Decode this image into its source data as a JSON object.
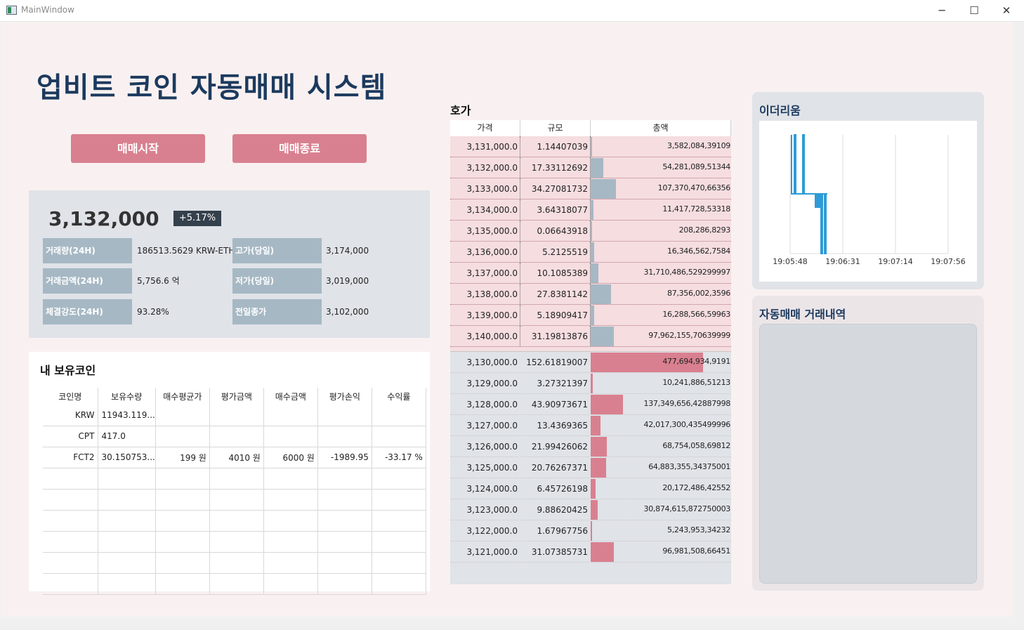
{
  "window": {
    "title": "MainWindow",
    "minimize": "─",
    "maximize": "☐",
    "close": "✕"
  },
  "header": {
    "title": "업비트 코인 자동매매 시스템"
  },
  "actions": {
    "start": "매매시작",
    "stop": "매매종료"
  },
  "ticker": {
    "price": "3,132,000",
    "change": "+5.17%",
    "stats": [
      {
        "label": "거래량(24H)",
        "value": "186513.5629 KRW-ETH"
      },
      {
        "label": "고가(당일)",
        "value": "3,174,000"
      },
      {
        "label": "거래금액(24H)",
        "value": "5,756.6 억"
      },
      {
        "label": "저가(당일)",
        "value": "3,019,000"
      },
      {
        "label": "체결강도(24H)",
        "value": "93.28%"
      },
      {
        "label": "전일종가",
        "value": "3,102,000"
      }
    ]
  },
  "holdings": {
    "title": "내 보유코인",
    "columns": [
      "코인명",
      "보유수량",
      "매수평균가",
      "평가금액",
      "매수금액",
      "평가손익",
      "수익률"
    ],
    "rows": [
      [
        "KRW",
        "11943.119...",
        "",
        "",
        "",
        "",
        ""
      ],
      [
        "CPT",
        "417.0",
        "",
        "",
        "",
        "",
        ""
      ],
      [
        "FCT2",
        "30.150753...",
        "199 원",
        "4010 원",
        "6000 원",
        "-1989.95",
        "-33.17 %"
      ],
      [
        "",
        "",
        "",
        "",
        "",
        "",
        ""
      ],
      [
        "",
        "",
        "",
        "",
        "",
        "",
        ""
      ],
      [
        "",
        "",
        "",
        "",
        "",
        "",
        ""
      ],
      [
        "",
        "",
        "",
        "",
        "",
        "",
        ""
      ],
      [
        "",
        "",
        "",
        "",
        "",
        "",
        ""
      ],
      [
        "",
        "",
        "",
        "",
        "",
        "",
        ""
      ]
    ]
  },
  "orderbook": {
    "title": "호가",
    "columns": [
      "가격",
      "규모",
      "총액"
    ],
    "asks": [
      {
        "price": "3,131,000.0",
        "qty": "1.14407039",
        "total": "3,582,084,39109",
        "size": 1.14407039
      },
      {
        "price": "3,132,000.0",
        "qty": "17.33112692",
        "total": "54,281,089,51344",
        "size": 17.33112692
      },
      {
        "price": "3,133,000.0",
        "qty": "34.27081732",
        "total": "107,370,470,66356",
        "size": 34.27081732
      },
      {
        "price": "3,134,000.0",
        "qty": "3.64318077",
        "total": "11,417,728,53318",
        "size": 3.64318077
      },
      {
        "price": "3,135,000.0",
        "qty": "0.06643918",
        "total": "208,286,8293",
        "size": 0.06643918
      },
      {
        "price": "3,136,000.0",
        "qty": "5.2125519",
        "total": "16,346,562,7584",
        "size": 5.2125519
      },
      {
        "price": "3,137,000.0",
        "qty": "10.1085389",
        "total": "31,710,486,529299997",
        "size": 10.1085389
      },
      {
        "price": "3,138,000.0",
        "qty": "27.8381142",
        "total": "87,356,002,3596",
        "size": 27.8381142
      },
      {
        "price": "3,139,000.0",
        "qty": "5.18909417",
        "total": "16,288,566,59963",
        "size": 5.18909417
      },
      {
        "price": "3,140,000.0",
        "qty": "31.19813876",
        "total": "97,962,155,70639999",
        "size": 31.19813876
      }
    ],
    "bids": [
      {
        "price": "3,130,000.0",
        "qty": "152.61819007",
        "total": "477,694,934,9191",
        "size": 152.61819007
      },
      {
        "price": "3,129,000.0",
        "qty": "3.27321397",
        "total": "10,241,886,51213",
        "size": 3.27321397
      },
      {
        "price": "3,128,000.0",
        "qty": "43.90973671",
        "total": "137,349,656,42887998",
        "size": 43.90973671
      },
      {
        "price": "3,127,000.0",
        "qty": "13.4369365",
        "total": "42,017,300,435499996",
        "size": 13.4369365
      },
      {
        "price": "3,126,000.0",
        "qty": "21.99426062",
        "total": "68,754,058,69812",
        "size": 21.99426062
      },
      {
        "price": "3,125,000.0",
        "qty": "20.76267371",
        "total": "64,883,355,34375001",
        "size": 20.76267371
      },
      {
        "price": "3,124,000.0",
        "qty": "6.45726198",
        "total": "20,172,486,42552",
        "size": 6.45726198
      },
      {
        "price": "3,123,000.0",
        "qty": "9.88620425",
        "total": "30,874,615,872750003",
        "size": 9.88620425
      },
      {
        "price": "3,122,000.0",
        "qty": "1.67967756",
        "total": "5,243,953,34232",
        "size": 1.67967756
      },
      {
        "price": "3,121,000.0",
        "qty": "31.07385731",
        "total": "96,981,508,66451",
        "size": 31.07385731
      }
    ],
    "colors": {
      "ask_bar": "#a6b8c4",
      "bid_bar": "#d98090",
      "ask_bg": "#f5dde0"
    }
  },
  "eth": {
    "title": "이더리움",
    "chart_data": {
      "type": "line",
      "x_ticks": [
        "19:05:48",
        "19:06:31",
        "19:07:14",
        "19:07:56"
      ],
      "series_color": "#2e9bd6",
      "grid": true
    }
  },
  "trades": {
    "title": "자동매매 거래내역"
  }
}
